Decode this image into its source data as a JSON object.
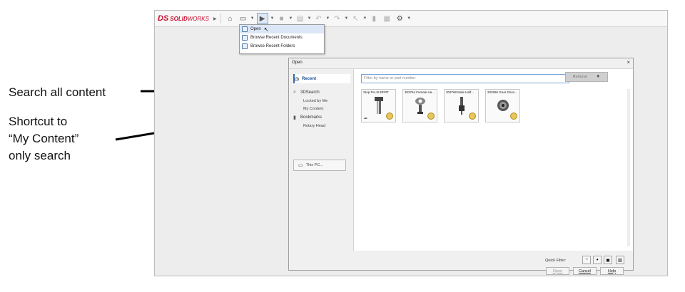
{
  "annotations": {
    "search_all": "Search all content",
    "shortcut_line1": "Shortcut to",
    "shortcut_line2": "“My Content”",
    "shortcut_line3": "only search"
  },
  "app": {
    "logo_ds": "DS",
    "logo_solid": "SOLID",
    "logo_works": "WORKS"
  },
  "toolbar": {
    "home_icon": "home-icon",
    "new_icon": "new-document-icon",
    "open_icon": "open-folder-icon",
    "save_icon": "save-icon",
    "print_icon": "print-icon",
    "undo_icon": "undo-icon",
    "redo_icon": "redo-icon",
    "select_icon": "select-arrow-icon",
    "options_icon": "gear-icon"
  },
  "open_menu": {
    "items": [
      "Open",
      "Browse Recent Documents",
      "Browse Recent Folders"
    ]
  },
  "dialog": {
    "title": "Open",
    "close": "×",
    "nav": {
      "recent": "Recent",
      "search": "3DSearch",
      "locked_by_me": "Locked by Me",
      "my_content": "My Content",
      "bookmarks": "Bookmarks",
      "rotary_head": "Rotary Head",
      "this_pc": "This PC..."
    },
    "search_placeholder": "Filter by name or part number",
    "remove_label": "Remove",
    "thumbnails": [
      "Stop Pin.SLDPRT",
      "303764 Female Ha...",
      "303768 Male Half...",
      "202586 Gear Drive..."
    ],
    "quick_filter_label": "Quick Filter:",
    "open_button": "Open",
    "cancel_button": "Cancel",
    "help_button": "Help"
  },
  "colors": {
    "accent": "#2b6cb0",
    "brand": "#c8102e"
  }
}
